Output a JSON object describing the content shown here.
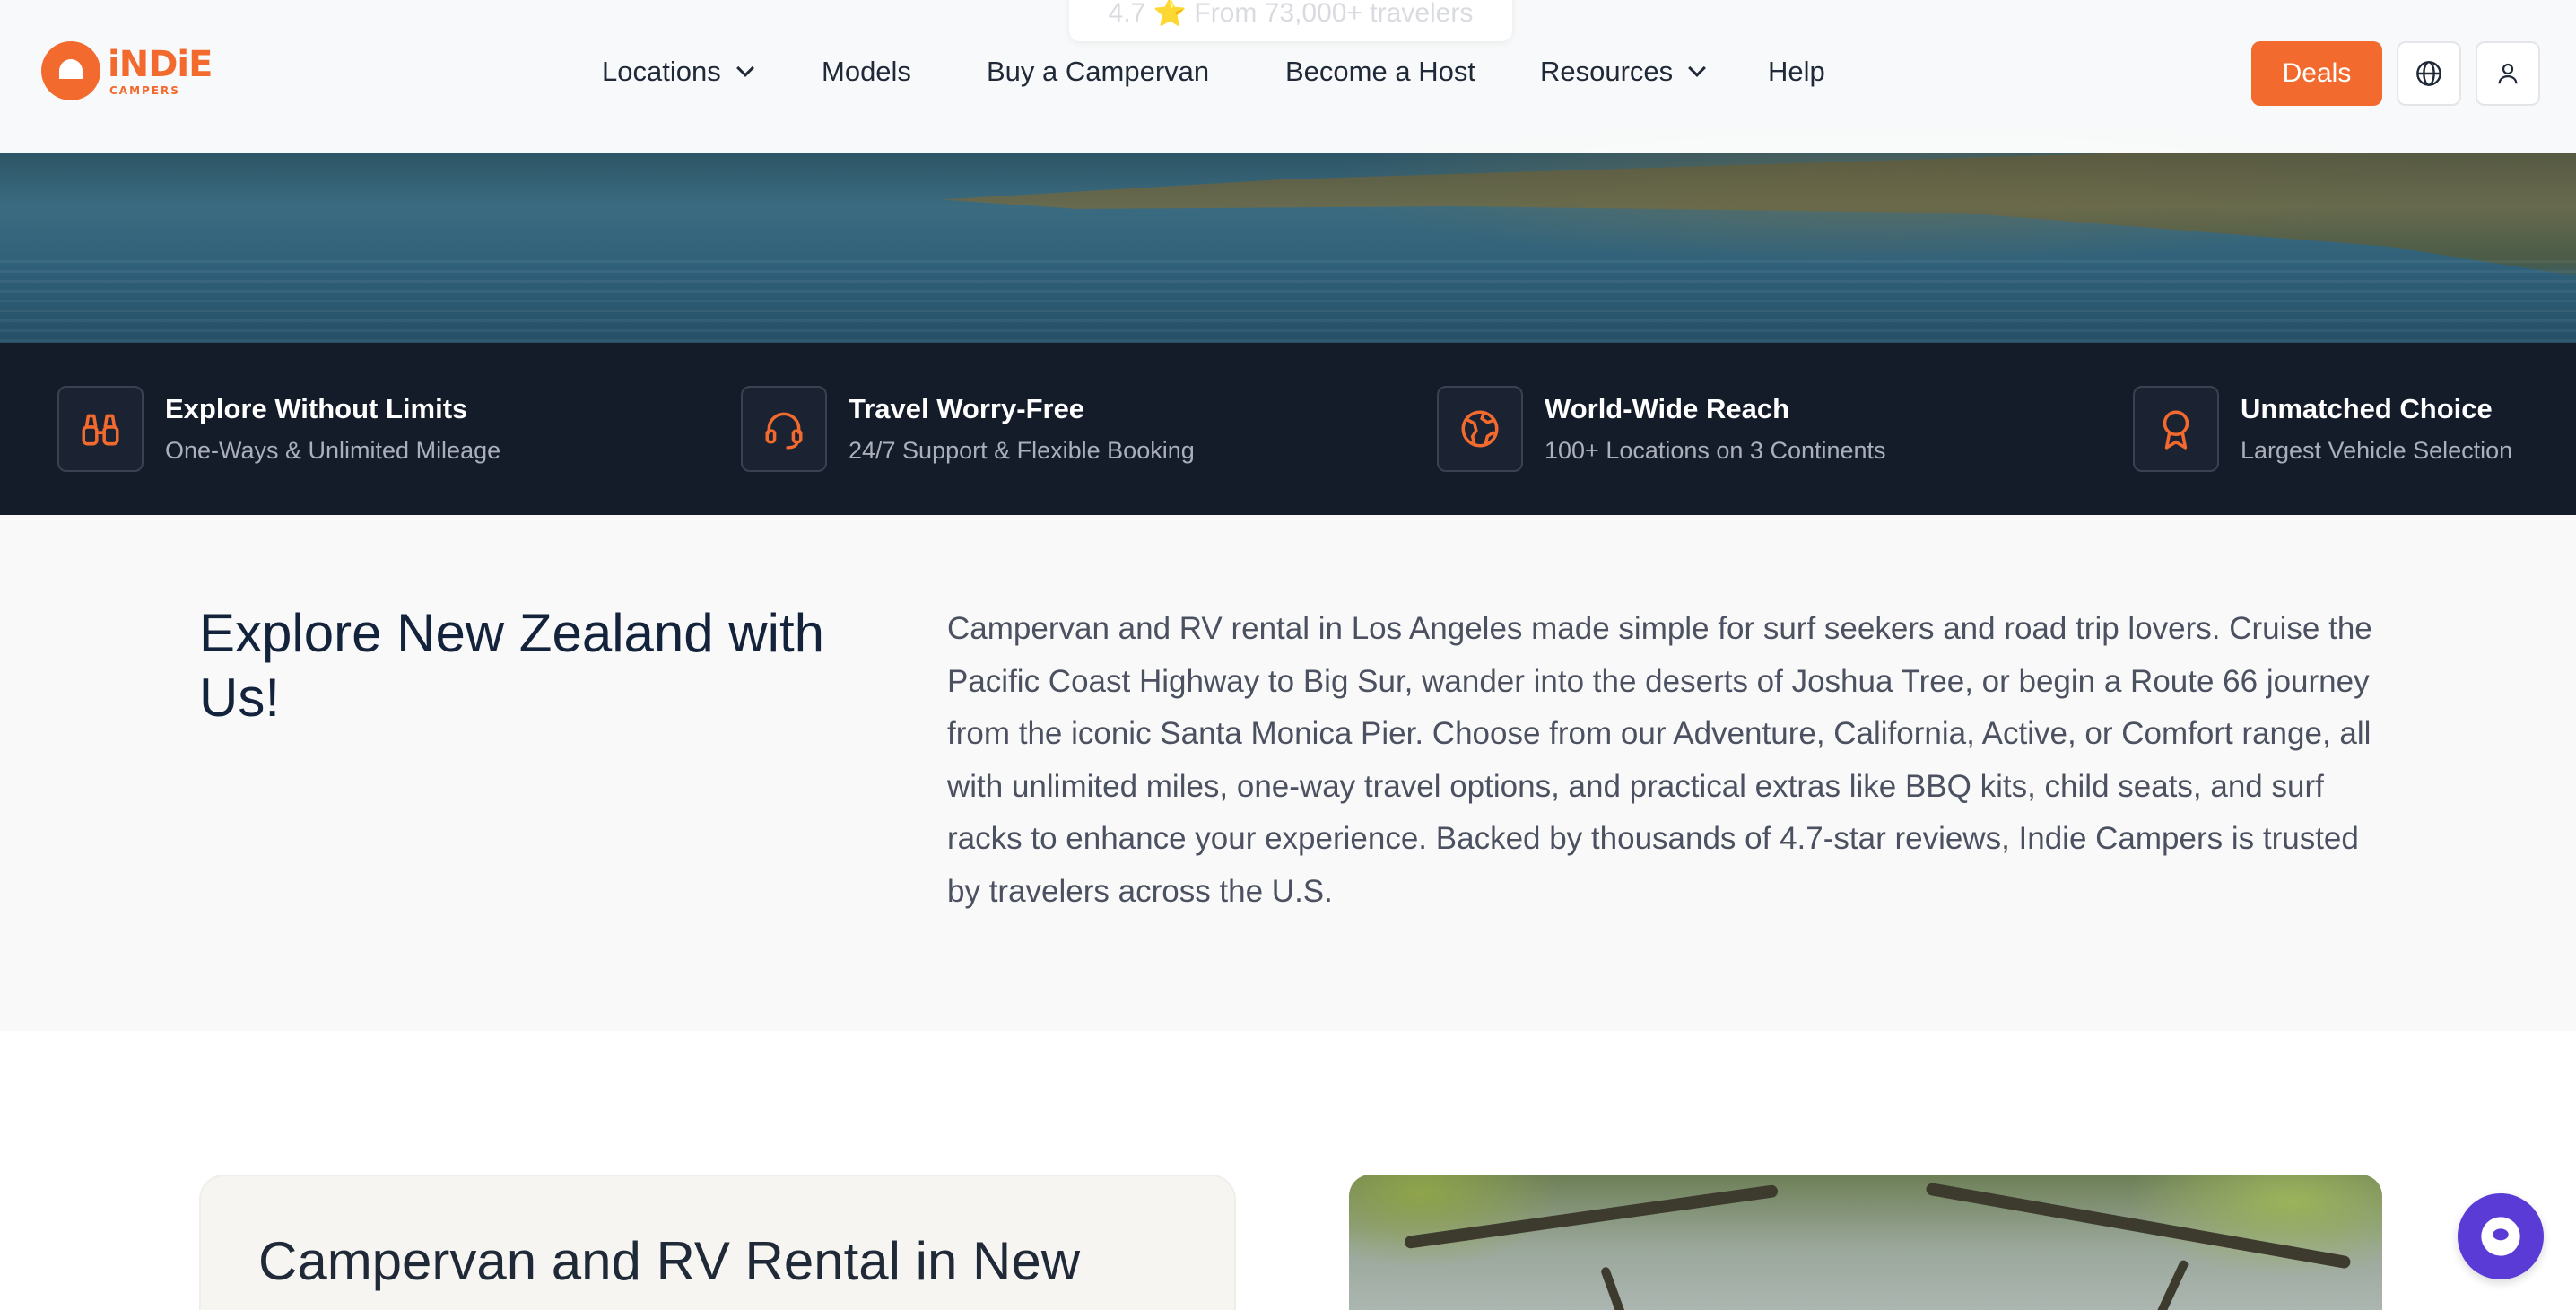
{
  "header": {
    "logo": {
      "word": "iNDiE",
      "sub": "CAMPERS"
    },
    "rating_pill": "4.7 ⭐ From 73,000+ travelers",
    "nav": {
      "locations": "Locations",
      "models": "Models",
      "buy": "Buy a Campervan",
      "host": "Become a Host",
      "resources": "Resources",
      "help": "Help"
    },
    "deals_label": "Deals",
    "icons": {
      "language": "globe-icon",
      "account": "user-icon"
    }
  },
  "features": [
    {
      "icon": "binoculars-icon",
      "title": "Explore Without Limits",
      "subtitle": "One-Ways & Unlimited Mileage"
    },
    {
      "icon": "headset-icon",
      "title": "Travel Worry-Free",
      "subtitle": "24/7 Support & Flexible Booking"
    },
    {
      "icon": "globe-icon",
      "title": "World-Wide Reach",
      "subtitle": "100+ Locations on 3 Continents"
    },
    {
      "icon": "award-icon",
      "title": "Unmatched Choice",
      "subtitle": "Largest Vehicle Selection"
    }
  ],
  "intro": {
    "title": "Explore New Zealand with Us!",
    "body": "Campervan and RV rental in Los Angeles made simple for surf seekers and road trip lovers. Cruise the Pacific Coast Highway to Big Sur, wander into the deserts of Joshua Tree, or begin a Route 66 journey from the iconic Santa Monica Pier. Choose from our Adventure, California, Active, or Comfort range, all with unlimited miles, one-way travel options, and practical extras like BBQ kits, child seats, and surf racks to enhance your experience. Backed by thousands of 4.7-star reviews, Indie Campers is trusted by travelers across the U.S."
  },
  "section": {
    "card_title": "Campervan and RV Rental in New"
  },
  "colors": {
    "brand_orange": "#f26a2e",
    "dark_navy": "#141b29",
    "chat_purple": "#5a3bd6"
  }
}
